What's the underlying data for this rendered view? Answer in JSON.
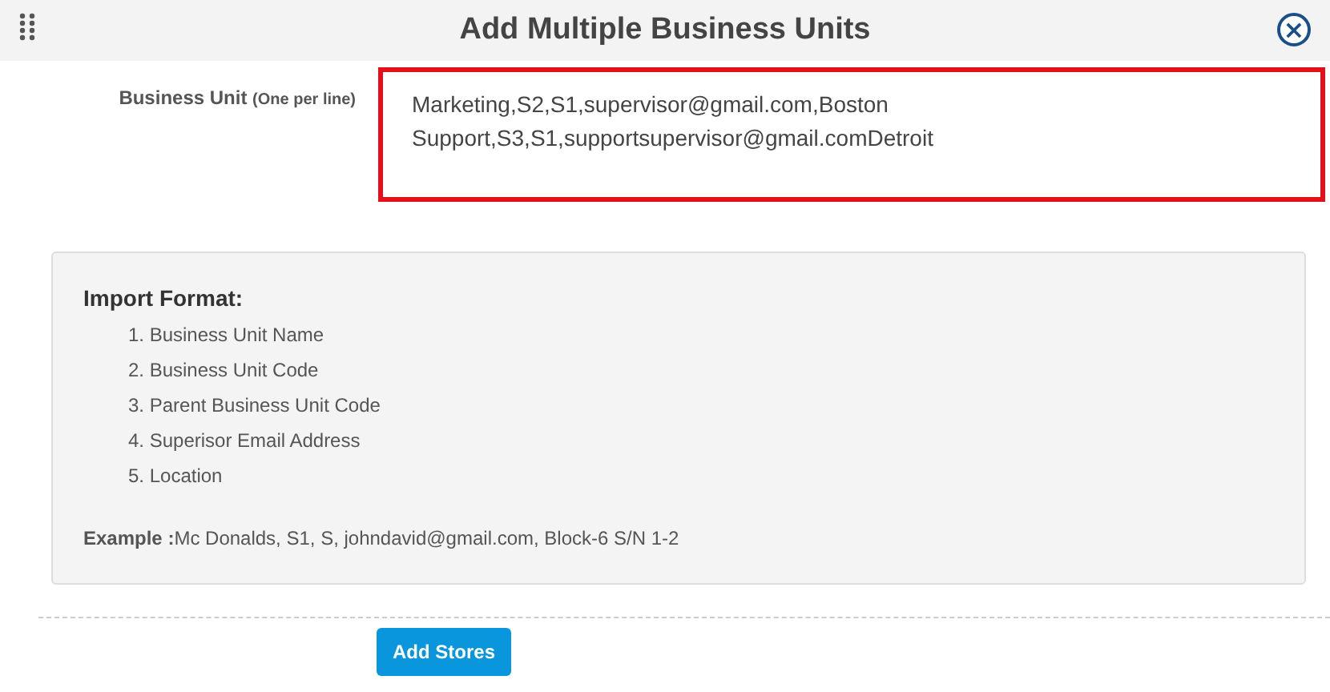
{
  "dialog": {
    "title": "Add Multiple Business Units",
    "close_icon": "×"
  },
  "field": {
    "label": "Business Unit",
    "hint": "(One per line)",
    "highlighted": true,
    "lines": [
      "Marketing,S2,S1,supervisor@gmail.com,Boston",
      "Support,S3,S1,supportsupervisor@gmail.comDetroit"
    ]
  },
  "import_format": {
    "title": "Import Format:",
    "items": [
      "1. Business Unit Name",
      "2. Business Unit Code",
      "3. Parent Business Unit Code",
      "4. Superisor Email Address",
      "5. Location"
    ],
    "example": "**Example :**Mc Donalds, S1, S, johndavid@gmail.com, Block-6 S/N 1-2"
  },
  "buttons": [
    "Add Stores"
  ]
}
